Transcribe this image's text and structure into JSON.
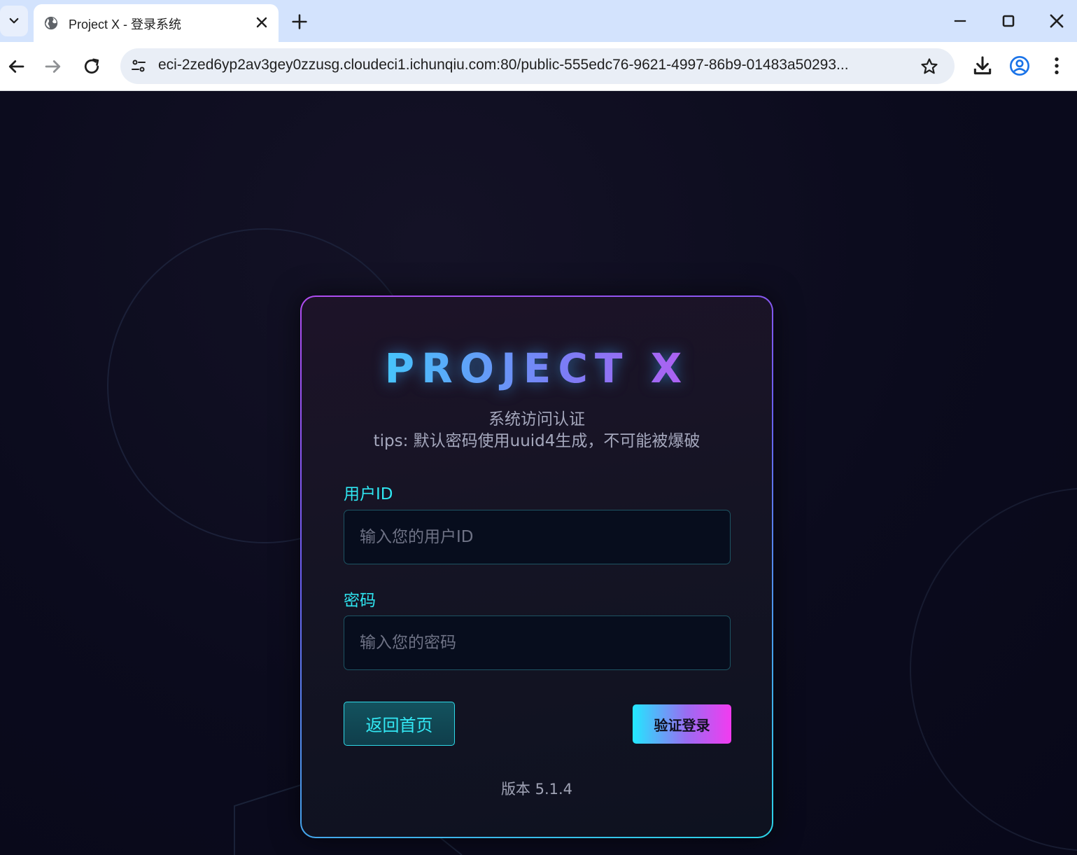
{
  "browser": {
    "tab_title": "Project X - 登录系统",
    "url": "eci-2zed6yp2av3gey0zzusg.cloudeci1.ichunqiu.com:80/public-555edc76-9621-4997-86b9-01483a50293..."
  },
  "login": {
    "logo": "PROJECT X",
    "subtitle": "系统访问认证",
    "tips": "tips: 默认密码使用uuid4生成，不可能被爆破",
    "user_label": "用户ID",
    "user_placeholder": "输入您的用户ID",
    "password_label": "密码",
    "password_placeholder": "输入您的密码",
    "home_button": "返回首页",
    "login_button": "验证登录",
    "version": "版本 5.1.4"
  },
  "colors": {
    "accent_cyan": "#2fe7f2",
    "accent_magenta": "#f23bf0",
    "background": "#0c0c1e"
  }
}
